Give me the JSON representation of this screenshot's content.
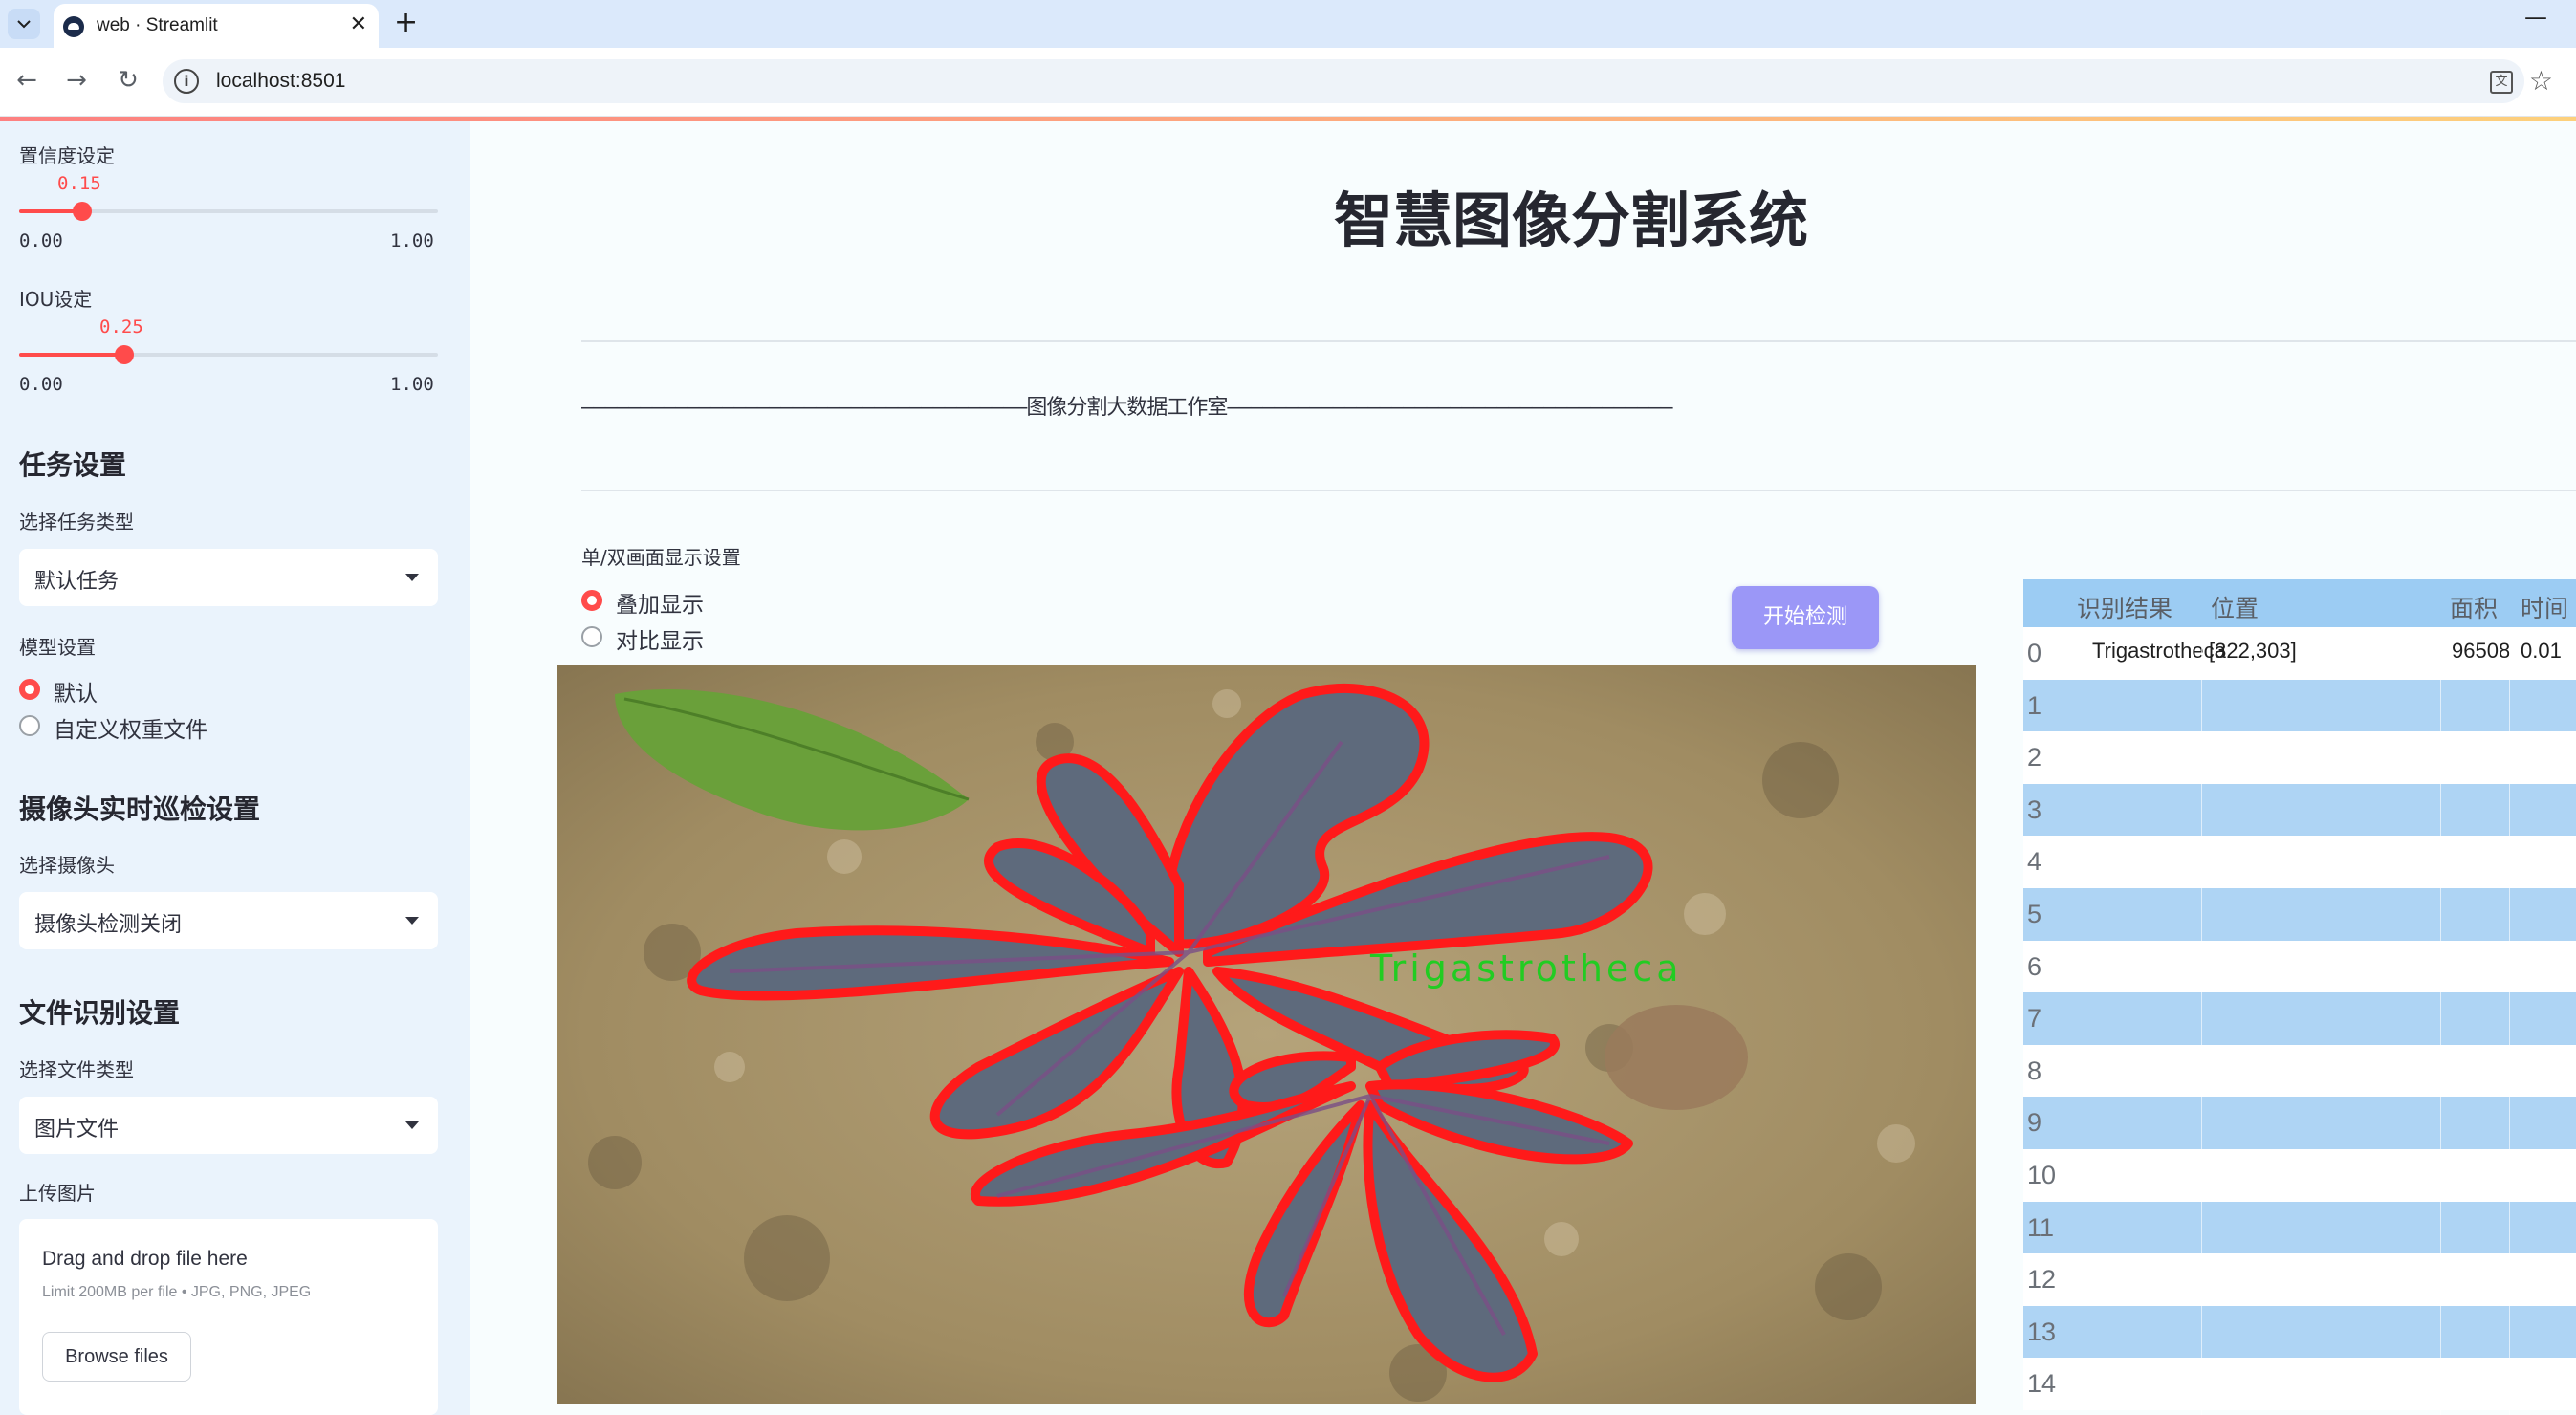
{
  "browser": {
    "tab_title": "web · Streamlit",
    "url": "localhost:8501",
    "new_tab_symbol": "+",
    "close_symbol": "✕"
  },
  "sidebar": {
    "confidence": {
      "label": "置信度设定",
      "value": 0.15,
      "value_text": "0.15",
      "min_text": "0.00",
      "max_text": "1.00"
    },
    "iou": {
      "label": "IOU设定",
      "value": 0.25,
      "value_text": "0.25",
      "min_text": "0.00",
      "max_text": "1.00"
    },
    "task_heading": "任务设置",
    "task_type_label": "选择任务类型",
    "task_type_value": "默认任务",
    "model_label": "模型设置",
    "model_options": [
      "默认",
      "自定义权重文件"
    ],
    "model_selected": 0,
    "camera_heading": "摄像头实时巡检设置",
    "camera_label": "选择摄像头",
    "camera_value": "摄像头检测关闭",
    "file_heading": "文件识别设置",
    "file_type_label": "选择文件类型",
    "file_type_value": "图片文件",
    "upload_label": "上传图片",
    "uploader": {
      "main_text": "Drag and drop file here",
      "sub_text": "Limit 200MB per file • JPG, PNG, JPEG",
      "button": "Browse files"
    }
  },
  "main": {
    "title": "智慧图像分割系统",
    "banner": "——————————————————————————————————————图像分割大数据工作室——————————————————————————————————————",
    "display_label": "单/双画面显示设置",
    "display_options": [
      "叠加显示",
      "对比显示"
    ],
    "display_selected": 0,
    "start_button": "开始检测",
    "detection_label": "Trigastrotheca"
  },
  "table": {
    "headers": [
      "识别结果",
      "位置",
      "面积",
      "时间"
    ],
    "rows": [
      {
        "idx": "0",
        "result": "Trigastrotheca",
        "position": "[322,303]",
        "area": "96508",
        "time": "0.01"
      },
      {
        "idx": "1"
      },
      {
        "idx": "2"
      },
      {
        "idx": "3"
      },
      {
        "idx": "4"
      },
      {
        "idx": "5"
      },
      {
        "idx": "6"
      },
      {
        "idx": "7"
      },
      {
        "idx": "8"
      },
      {
        "idx": "9"
      },
      {
        "idx": "10"
      },
      {
        "idx": "11"
      },
      {
        "idx": "12"
      },
      {
        "idx": "13"
      },
      {
        "idx": "14"
      }
    ]
  },
  "colors": {
    "accent": "#ff4b4b",
    "button": "#9b97f7",
    "table_header": "#9cccf3",
    "table_row_alt": "#aed4f4",
    "sidebar_bg": "#eaf3fc",
    "segmentation_outline": "#ff1a1a",
    "detection_label": "#22cc22"
  }
}
